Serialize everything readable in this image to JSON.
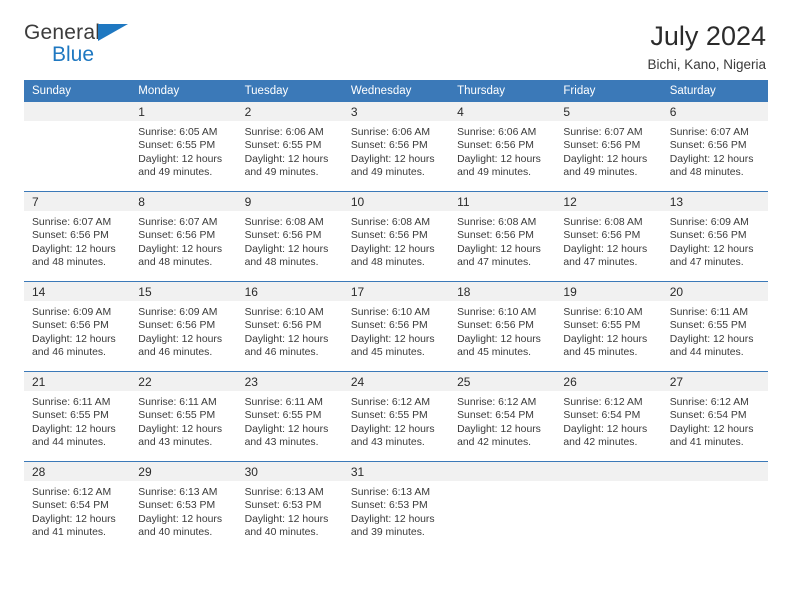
{
  "brand": {
    "name_top": "General",
    "name_bottom": "Blue",
    "accent_color": "#1f78c1"
  },
  "header": {
    "title": "July 2024",
    "subtitle": "Bichi, Kano, Nigeria"
  },
  "calendar": {
    "header_bg": "#3b79b8",
    "daynum_bg": "#f1f1f1",
    "weekdays": [
      "Sunday",
      "Monday",
      "Tuesday",
      "Wednesday",
      "Thursday",
      "Friday",
      "Saturday"
    ],
    "weeks": [
      [
        {
          "day": "",
          "sunrise": "",
          "sunset": "",
          "daylight1": "",
          "daylight2": ""
        },
        {
          "day": "1",
          "sunrise": "Sunrise: 6:05 AM",
          "sunset": "Sunset: 6:55 PM",
          "daylight1": "Daylight: 12 hours",
          "daylight2": "and 49 minutes."
        },
        {
          "day": "2",
          "sunrise": "Sunrise: 6:06 AM",
          "sunset": "Sunset: 6:55 PM",
          "daylight1": "Daylight: 12 hours",
          "daylight2": "and 49 minutes."
        },
        {
          "day": "3",
          "sunrise": "Sunrise: 6:06 AM",
          "sunset": "Sunset: 6:56 PM",
          "daylight1": "Daylight: 12 hours",
          "daylight2": "and 49 minutes."
        },
        {
          "day": "4",
          "sunrise": "Sunrise: 6:06 AM",
          "sunset": "Sunset: 6:56 PM",
          "daylight1": "Daylight: 12 hours",
          "daylight2": "and 49 minutes."
        },
        {
          "day": "5",
          "sunrise": "Sunrise: 6:07 AM",
          "sunset": "Sunset: 6:56 PM",
          "daylight1": "Daylight: 12 hours",
          "daylight2": "and 49 minutes."
        },
        {
          "day": "6",
          "sunrise": "Sunrise: 6:07 AM",
          "sunset": "Sunset: 6:56 PM",
          "daylight1": "Daylight: 12 hours",
          "daylight2": "and 48 minutes."
        }
      ],
      [
        {
          "day": "7",
          "sunrise": "Sunrise: 6:07 AM",
          "sunset": "Sunset: 6:56 PM",
          "daylight1": "Daylight: 12 hours",
          "daylight2": "and 48 minutes."
        },
        {
          "day": "8",
          "sunrise": "Sunrise: 6:07 AM",
          "sunset": "Sunset: 6:56 PM",
          "daylight1": "Daylight: 12 hours",
          "daylight2": "and 48 minutes."
        },
        {
          "day": "9",
          "sunrise": "Sunrise: 6:08 AM",
          "sunset": "Sunset: 6:56 PM",
          "daylight1": "Daylight: 12 hours",
          "daylight2": "and 48 minutes."
        },
        {
          "day": "10",
          "sunrise": "Sunrise: 6:08 AM",
          "sunset": "Sunset: 6:56 PM",
          "daylight1": "Daylight: 12 hours",
          "daylight2": "and 48 minutes."
        },
        {
          "day": "11",
          "sunrise": "Sunrise: 6:08 AM",
          "sunset": "Sunset: 6:56 PM",
          "daylight1": "Daylight: 12 hours",
          "daylight2": "and 47 minutes."
        },
        {
          "day": "12",
          "sunrise": "Sunrise: 6:08 AM",
          "sunset": "Sunset: 6:56 PM",
          "daylight1": "Daylight: 12 hours",
          "daylight2": "and 47 minutes."
        },
        {
          "day": "13",
          "sunrise": "Sunrise: 6:09 AM",
          "sunset": "Sunset: 6:56 PM",
          "daylight1": "Daylight: 12 hours",
          "daylight2": "and 47 minutes."
        }
      ],
      [
        {
          "day": "14",
          "sunrise": "Sunrise: 6:09 AM",
          "sunset": "Sunset: 6:56 PM",
          "daylight1": "Daylight: 12 hours",
          "daylight2": "and 46 minutes."
        },
        {
          "day": "15",
          "sunrise": "Sunrise: 6:09 AM",
          "sunset": "Sunset: 6:56 PM",
          "daylight1": "Daylight: 12 hours",
          "daylight2": "and 46 minutes."
        },
        {
          "day": "16",
          "sunrise": "Sunrise: 6:10 AM",
          "sunset": "Sunset: 6:56 PM",
          "daylight1": "Daylight: 12 hours",
          "daylight2": "and 46 minutes."
        },
        {
          "day": "17",
          "sunrise": "Sunrise: 6:10 AM",
          "sunset": "Sunset: 6:56 PM",
          "daylight1": "Daylight: 12 hours",
          "daylight2": "and 45 minutes."
        },
        {
          "day": "18",
          "sunrise": "Sunrise: 6:10 AM",
          "sunset": "Sunset: 6:56 PM",
          "daylight1": "Daylight: 12 hours",
          "daylight2": "and 45 minutes."
        },
        {
          "day": "19",
          "sunrise": "Sunrise: 6:10 AM",
          "sunset": "Sunset: 6:55 PM",
          "daylight1": "Daylight: 12 hours",
          "daylight2": "and 45 minutes."
        },
        {
          "day": "20",
          "sunrise": "Sunrise: 6:11 AM",
          "sunset": "Sunset: 6:55 PM",
          "daylight1": "Daylight: 12 hours",
          "daylight2": "and 44 minutes."
        }
      ],
      [
        {
          "day": "21",
          "sunrise": "Sunrise: 6:11 AM",
          "sunset": "Sunset: 6:55 PM",
          "daylight1": "Daylight: 12 hours",
          "daylight2": "and 44 minutes."
        },
        {
          "day": "22",
          "sunrise": "Sunrise: 6:11 AM",
          "sunset": "Sunset: 6:55 PM",
          "daylight1": "Daylight: 12 hours",
          "daylight2": "and 43 minutes."
        },
        {
          "day": "23",
          "sunrise": "Sunrise: 6:11 AM",
          "sunset": "Sunset: 6:55 PM",
          "daylight1": "Daylight: 12 hours",
          "daylight2": "and 43 minutes."
        },
        {
          "day": "24",
          "sunrise": "Sunrise: 6:12 AM",
          "sunset": "Sunset: 6:55 PM",
          "daylight1": "Daylight: 12 hours",
          "daylight2": "and 43 minutes."
        },
        {
          "day": "25",
          "sunrise": "Sunrise: 6:12 AM",
          "sunset": "Sunset: 6:54 PM",
          "daylight1": "Daylight: 12 hours",
          "daylight2": "and 42 minutes."
        },
        {
          "day": "26",
          "sunrise": "Sunrise: 6:12 AM",
          "sunset": "Sunset: 6:54 PM",
          "daylight1": "Daylight: 12 hours",
          "daylight2": "and 42 minutes."
        },
        {
          "day": "27",
          "sunrise": "Sunrise: 6:12 AM",
          "sunset": "Sunset: 6:54 PM",
          "daylight1": "Daylight: 12 hours",
          "daylight2": "and 41 minutes."
        }
      ],
      [
        {
          "day": "28",
          "sunrise": "Sunrise: 6:12 AM",
          "sunset": "Sunset: 6:54 PM",
          "daylight1": "Daylight: 12 hours",
          "daylight2": "and 41 minutes."
        },
        {
          "day": "29",
          "sunrise": "Sunrise: 6:13 AM",
          "sunset": "Sunset: 6:53 PM",
          "daylight1": "Daylight: 12 hours",
          "daylight2": "and 40 minutes."
        },
        {
          "day": "30",
          "sunrise": "Sunrise: 6:13 AM",
          "sunset": "Sunset: 6:53 PM",
          "daylight1": "Daylight: 12 hours",
          "daylight2": "and 40 minutes."
        },
        {
          "day": "31",
          "sunrise": "Sunrise: 6:13 AM",
          "sunset": "Sunset: 6:53 PM",
          "daylight1": "Daylight: 12 hours",
          "daylight2": "and 39 minutes."
        },
        {
          "day": "",
          "sunrise": "",
          "sunset": "",
          "daylight1": "",
          "daylight2": ""
        },
        {
          "day": "",
          "sunrise": "",
          "sunset": "",
          "daylight1": "",
          "daylight2": ""
        },
        {
          "day": "",
          "sunrise": "",
          "sunset": "",
          "daylight1": "",
          "daylight2": ""
        }
      ]
    ]
  }
}
